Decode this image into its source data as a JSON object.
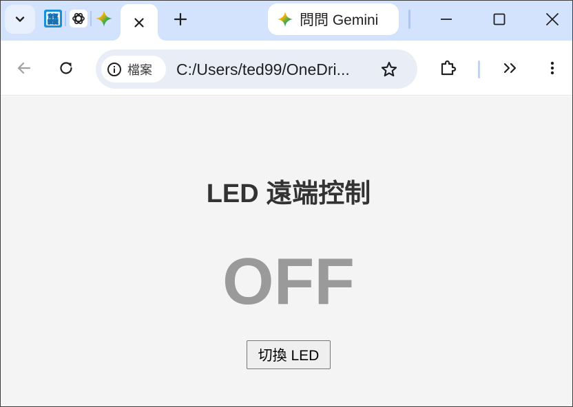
{
  "tabs": {
    "pinned_icons": [
      "translator-icon",
      "chatgpt-icon",
      "gemini-icon"
    ],
    "active_tab_close": "✕",
    "new_tab": "+",
    "gemini_chip_label": "問問 Gemini"
  },
  "toolbar": {
    "site_info_label": "檔案",
    "url": "C:/Users/ted99/OneDri..."
  },
  "page": {
    "heading": "LED 遠端控制",
    "status": "OFF",
    "toggle_button_label": "切換 LED"
  },
  "colors": {
    "tabstrip_bg": "#d3e3fd",
    "omnibox_bg": "#e9eef6",
    "page_bg": "#f4f4f4",
    "status_off": "#9a9a9a"
  }
}
